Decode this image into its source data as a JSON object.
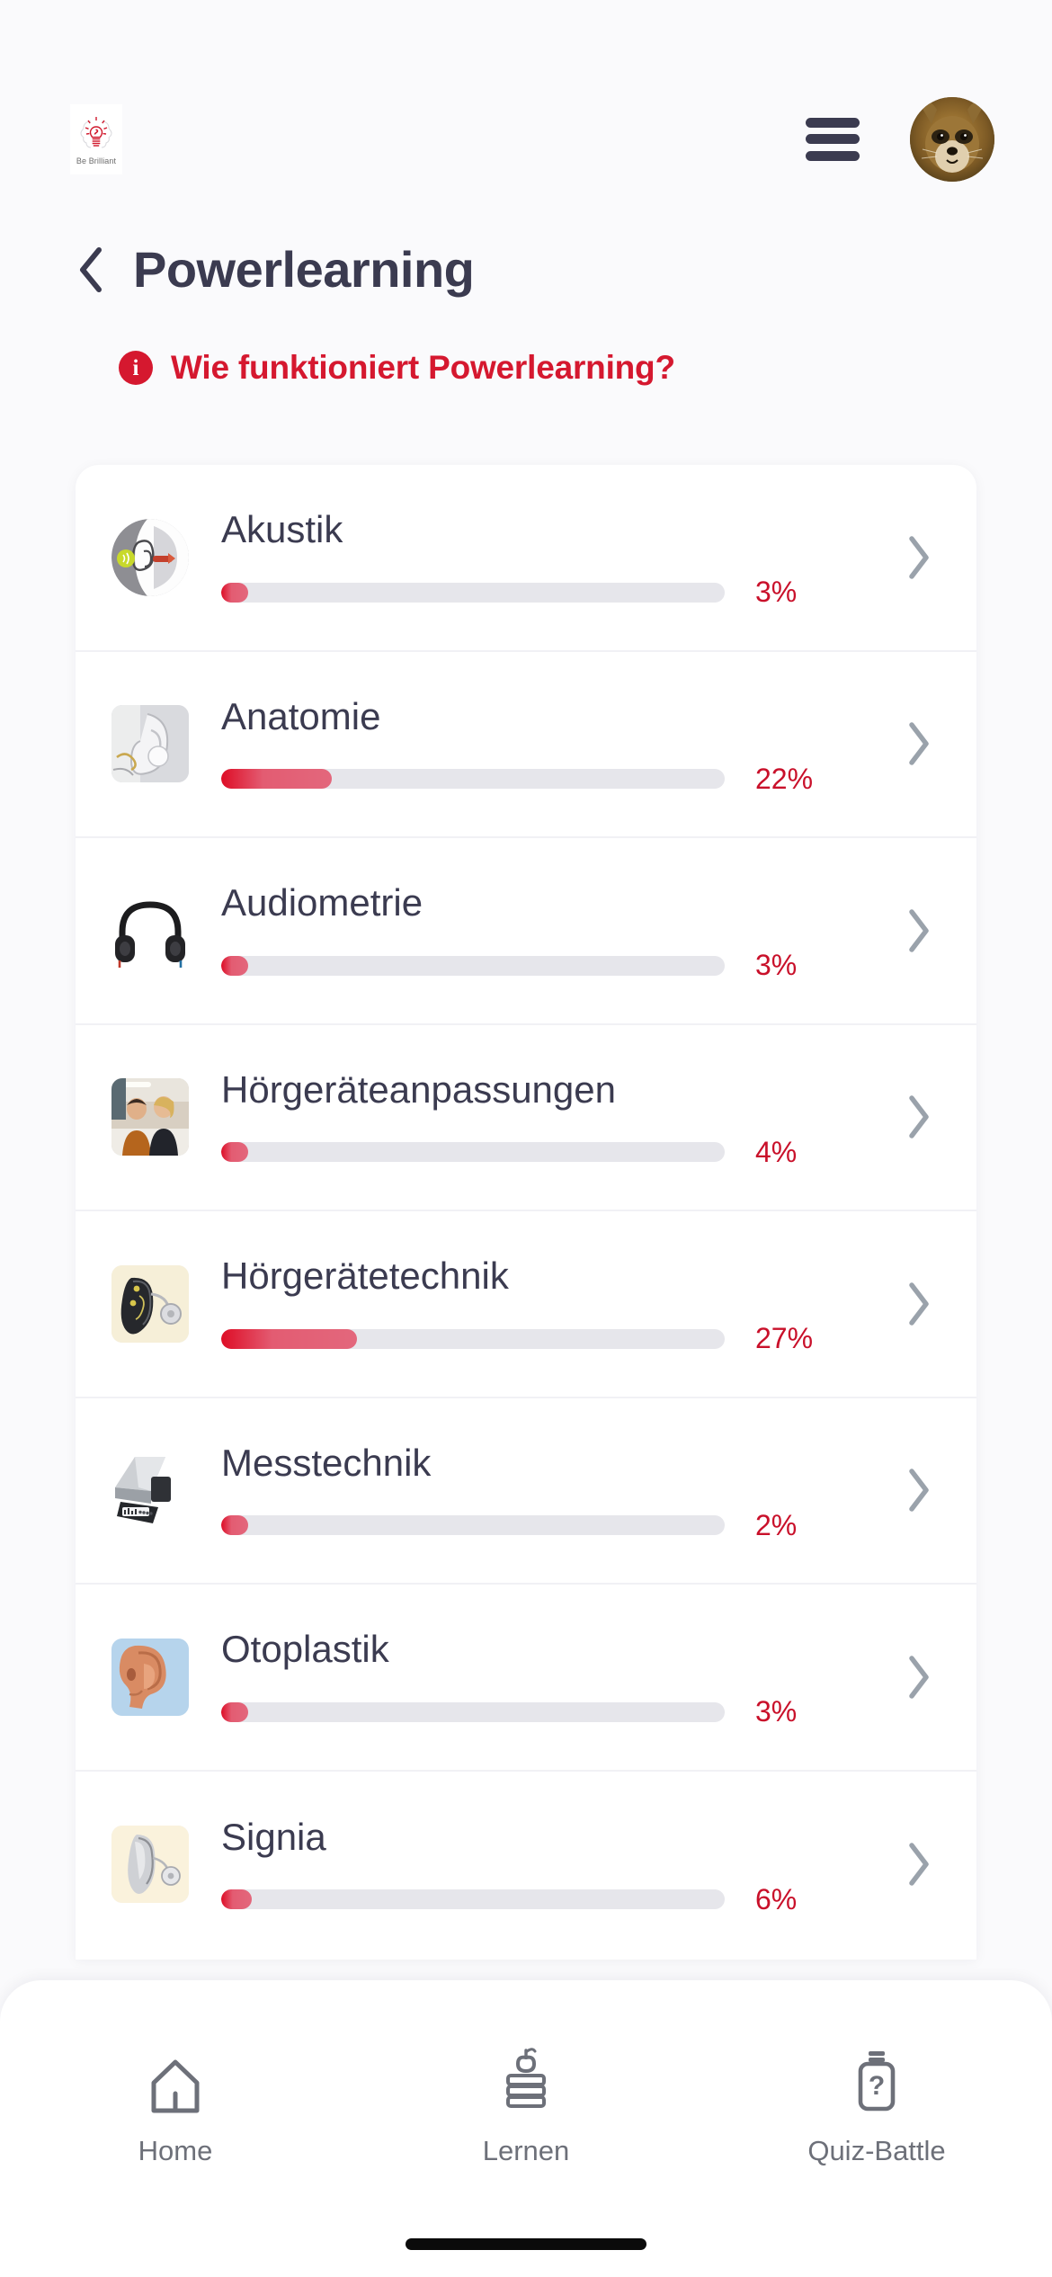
{
  "header": {
    "logo_text": "Be Brilliant",
    "logo_icon": "brain-lightbulb-logo",
    "menu_icon": "hamburger-menu-icon",
    "avatar_icon": "user-avatar-raccoon"
  },
  "page": {
    "back_icon": "back-chevron-icon",
    "title": "Powerlearning",
    "info_icon": "info-circle-icon",
    "info_link": "Wie funktioniert Powerlearning?"
  },
  "colors": {
    "accent_red": "#d5182f",
    "progress_red": "#c9102a",
    "title_navy": "#3b3b50",
    "track_grey": "#e6e6eb",
    "chevron_grey": "#9aa2ab",
    "page_bg": "#fafafc"
  },
  "topics": [
    {
      "label": "Akustik",
      "percent_text": "3%",
      "percent": 3,
      "thumb": "ear-anatomy-icon",
      "thumb_shape": "circle"
    },
    {
      "label": "Anatomie",
      "percent_text": "22%",
      "percent": 22,
      "thumb": "ear-model-photo",
      "thumb_shape": "rounded"
    },
    {
      "label": "Audiometrie",
      "percent_text": "3%",
      "percent": 3,
      "thumb": "headphones-icon",
      "thumb_shape": "plain"
    },
    {
      "label": "Hörgeräteanpassungen",
      "percent_text": "4%",
      "percent": 4,
      "thumb": "consultation-photo",
      "thumb_shape": "rounded"
    },
    {
      "label": "Hörgerätetechnik",
      "percent_text": "27%",
      "percent": 27,
      "thumb": "bte-hearing-aid-photo",
      "thumb_shape": "rounded"
    },
    {
      "label": "Messtechnik",
      "percent_text": "2%",
      "percent": 2,
      "thumb": "measuring-device-photo",
      "thumb_shape": "plain"
    },
    {
      "label": "Otoplastik",
      "percent_text": "3%",
      "percent": 3,
      "thumb": "ear-mould-icon",
      "thumb_shape": "rounded"
    },
    {
      "label": "Signia",
      "percent_text": "6%",
      "percent": 6,
      "thumb": "signia-hearing-aid-photo",
      "thumb_shape": "rounded"
    }
  ],
  "row_chevron_icon": "chevron-right-icon",
  "bottom_nav": [
    {
      "label": "Home",
      "icon": "home-icon"
    },
    {
      "label": "Lernen",
      "icon": "books-apple-icon"
    },
    {
      "label": "Quiz-Battle",
      "icon": "quiz-bottle-icon"
    }
  ]
}
